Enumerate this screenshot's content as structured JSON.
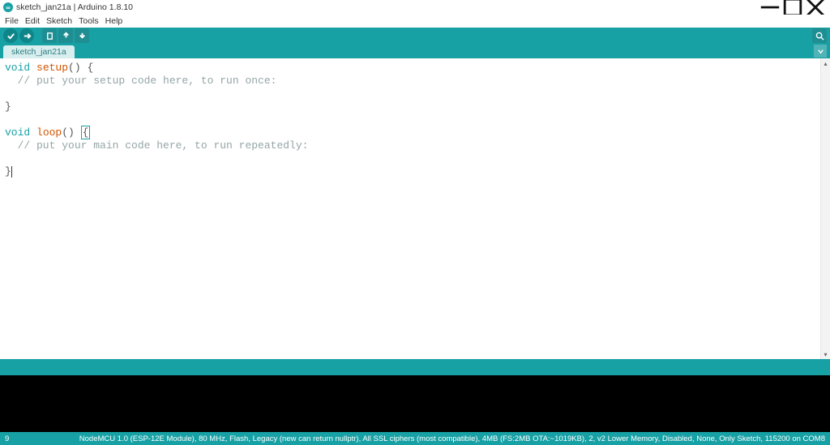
{
  "title": "sketch_jan21a | Arduino 1.8.10",
  "menu": [
    "File",
    "Edit",
    "Sketch",
    "Tools",
    "Help"
  ],
  "tab": "sketch_jan21a",
  "code": {
    "l1_kw": "void",
    "l1_fn": "setup",
    "l1_rest": "() {",
    "l2_com": "  // put your setup code here, to run once:",
    "l4": "}",
    "l6_kw": "void",
    "l6_fn": "loop",
    "l6_rest_a": "() ",
    "l6_rest_b": "{",
    "l7_com": "  // put your main code here, to run repeatedly:",
    "l9": "}"
  },
  "status": {
    "line": "9",
    "board": "NodeMCU 1.0 (ESP-12E Module), 80 MHz, Flash, Legacy (new can return nullptr), All SSL ciphers (most compatible), 4MB (FS:2MB OTA:~1019KB), 2, v2 Lower Memory, Disabled, None, Only Sketch, 115200 on COM8"
  }
}
